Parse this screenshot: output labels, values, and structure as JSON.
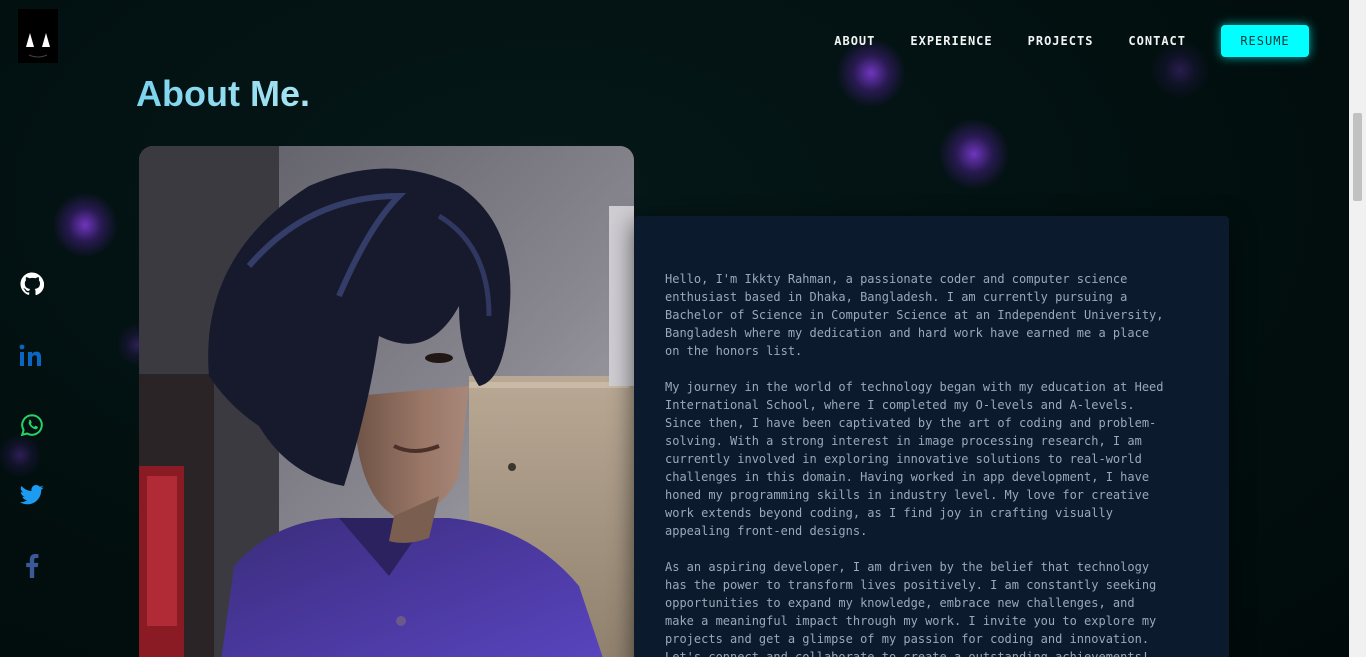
{
  "nav": {
    "items": [
      {
        "label": "ABOUT"
      },
      {
        "label": "EXPERIENCE"
      },
      {
        "label": "PROJECTS"
      },
      {
        "label": "CONTACT"
      }
    ],
    "resume_label": "RESUME"
  },
  "about": {
    "title": "About Me.",
    "paragraphs": [
      "Hello, I'm Ikkty Rahman, a passionate coder and computer science enthusiast based in Dhaka, Bangladesh. I am currently pursuing a Bachelor of Science in Computer Science at an Independent University, Bangladesh where my dedication and hard work have earned me a place on the honors list.",
      "My journey in the world of technology began with my education at Heed International School, where I completed my O-levels and A-levels. Since then, I have been captivated by the art of coding and problem-solving. With a strong interest in image processing research, I am currently involved in exploring innovative solutions to real-world challenges in this domain. Having worked in app development, I have honed my programming skills in industry level. My love for creative work extends beyond coding, as I find joy in crafting visually appealing front-end designs.",
      "As an aspiring developer, I am driven by the belief that technology has the power to transform lives positively. I am constantly seeking opportunities to expand my knowledge, embrace new challenges, and make a meaningful impact through my work. I invite you to explore my projects and get a glimpse of my passion for coding and innovation. Let's connect and collaborate to create a outstanding achievements!"
    ]
  },
  "social": [
    {
      "icon": "github-icon",
      "color": "#ffffff"
    },
    {
      "icon": "linkedin-icon",
      "color": "#0a66c2"
    },
    {
      "icon": "whatsapp-icon",
      "color": "#25d366"
    },
    {
      "icon": "twitter-icon",
      "color": "#1d9bf0"
    },
    {
      "icon": "facebook-icon",
      "color": "#3b5998"
    }
  ],
  "colors": {
    "accent": "#00ffff",
    "title": "#8bdcf0",
    "card_bg": "#0b1a2c",
    "body_text": "#9aa9b8"
  }
}
